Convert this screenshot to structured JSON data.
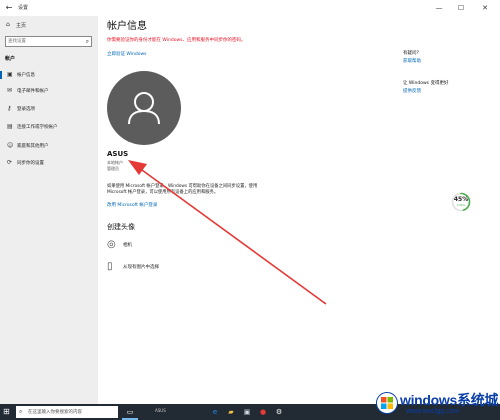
{
  "titlebar": {
    "back_icon": "back-arrow-icon",
    "title": "设置",
    "minimize": "—",
    "maximize": "☐",
    "close": "✕"
  },
  "sidebar": {
    "home_label": "主页",
    "search_placeholder": "查找设置",
    "section_title": "帐户",
    "items": [
      {
        "label": "帐户信息",
        "icon": "person-card-icon"
      },
      {
        "label": "电子邮件和帐户",
        "icon": "mail-icon"
      },
      {
        "label": "登录选项",
        "icon": "key-icon"
      },
      {
        "label": "连接工作或学校帐户",
        "icon": "briefcase-icon"
      },
      {
        "label": "家庭和其他用户",
        "icon": "people-icon"
      },
      {
        "label": "同步你的设置",
        "icon": "sync-icon"
      }
    ]
  },
  "main": {
    "title": "帐户信息",
    "warning": "你需要验证你的身份才能在 Windows、应用和服务中同步你的密码。",
    "verify_link": "立即验证 Windows",
    "account_name": "ASUS",
    "account_type": "本地帐户",
    "account_role": "管理员",
    "description": "如果使用 Microsoft 帐户登录，Windows 可帮助你在设备之间同步设置，使用 Microsoft 帐户登录，可以使用所有设备上的应用和服务。",
    "ms_link": "改用 Microsoft 帐户登录",
    "create_title": "创建头像",
    "options": [
      {
        "label": "相机",
        "icon": "camera-icon"
      },
      {
        "label": "从现有图片中选择",
        "icon": "picture-icon"
      }
    ]
  },
  "right": {
    "section1_head": "有疑问？",
    "section1_link": "获取帮助",
    "section2_head": "让 Windows 变得更好",
    "section2_link": "提供反馈"
  },
  "widget": {
    "percent": 45,
    "percent_text": "45%",
    "sub": "0.5K/s",
    "color": "#4caf50"
  },
  "taskbar": {
    "search_label": "在这里输入你要搜索的内容",
    "app_label": "ASUS",
    "accent": "#76b9ed"
  },
  "watermark": {
    "brand": "windows系统城",
    "url": "www.wxclgg.com"
  },
  "colors": {
    "warning": "#e81123",
    "link": "#0066b4",
    "avatar_bg": "#5c5c5c",
    "arrow": "#e53935"
  }
}
